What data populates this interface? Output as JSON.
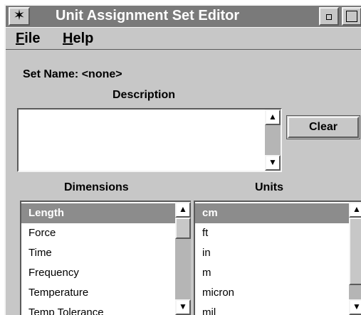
{
  "window": {
    "title": "Unit Assignment Set Editor",
    "menu_icon": "sparkle-star-icon",
    "minimize_icon": "minimize-icon",
    "maximize_icon": "maximize-icon"
  },
  "menubar": {
    "file": {
      "mnemonic": "F",
      "rest": "ile"
    },
    "help": {
      "mnemonic": "H",
      "rest": "elp"
    }
  },
  "set_name": "Set Name: <none>",
  "description": {
    "label": "Description",
    "value": ""
  },
  "clear_button": "Clear",
  "dimensions": {
    "header": "Dimensions",
    "items": [
      "Length",
      "Force",
      "Time",
      "Frequency",
      "Temperature",
      "Temp Tolerance"
    ],
    "selected": "Length"
  },
  "units": {
    "header": "Units",
    "items": [
      "cm",
      "ft",
      "in",
      "m",
      "micron",
      "mil"
    ],
    "selected": "cm"
  },
  "colors": {
    "window_bg": "#c7c7c7",
    "titlebar": "#7a7a7a",
    "selection": "#8c8c8c"
  }
}
